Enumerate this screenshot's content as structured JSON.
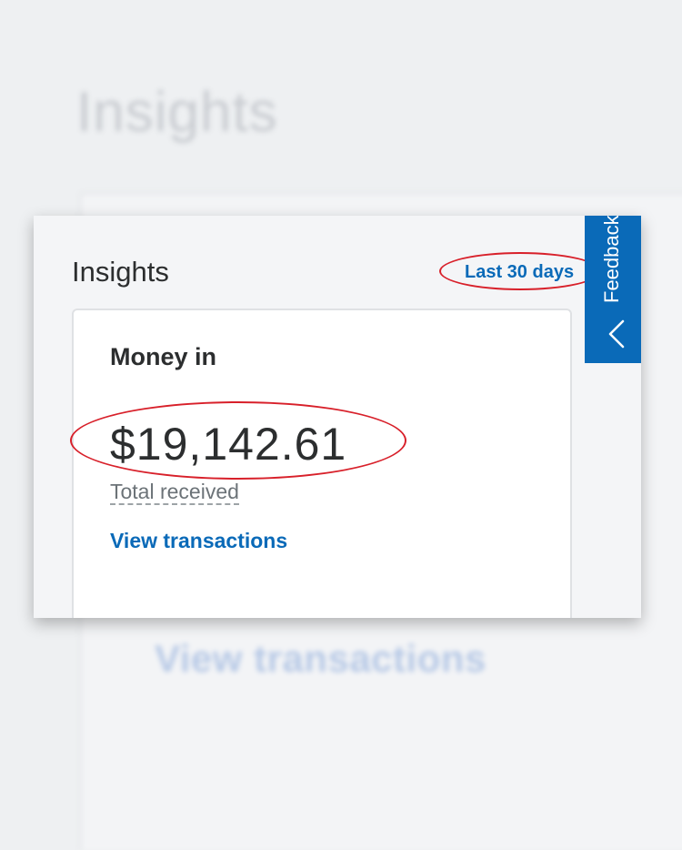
{
  "background": {
    "title": "Insights",
    "link": "View transactions"
  },
  "card": {
    "title": "Insights",
    "range_link": "Last 30 days"
  },
  "money_in": {
    "heading": "Money in",
    "amount": "$19,142.61",
    "amount_label": "Total received",
    "link": "View transactions"
  },
  "feedback": {
    "label": "Feedback",
    "icon": "chevron-left-icon"
  },
  "colors": {
    "accent": "#0a6ab8",
    "annotation": "#d8202a",
    "text": "#2c2e2f"
  }
}
